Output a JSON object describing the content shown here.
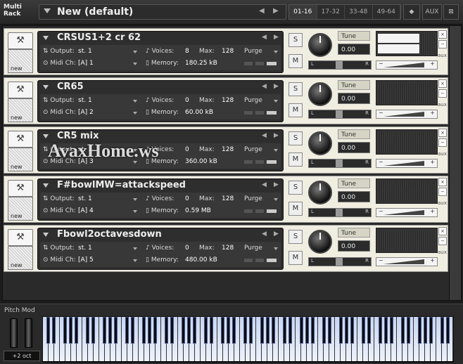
{
  "header": {
    "multi_rack_label_line1": "Multi",
    "multi_rack_label_line2": "Rack",
    "preset_name": "New (default)",
    "prev_arrow": "◀",
    "next_arrow": "▶",
    "ranges": [
      "01-16",
      "17-32",
      "33-48",
      "49-64"
    ],
    "active_range": "01-16",
    "aux_label": "AUX"
  },
  "instruments": [
    {
      "name": "CRSUS1+2 cr 62",
      "output_label": "Output:",
      "output": "st. 1",
      "voices_label": "Voices:",
      "voices": "8",
      "max_label": "Max:",
      "max": "128",
      "purge": "Purge",
      "midi_label": "Midi Ch:",
      "midi": "[A] 1",
      "memory_label": "Memory:",
      "memory": "180.25 kB",
      "tune_label": "Tune",
      "tune": "0.00",
      "solo": "S",
      "mute": "M",
      "new_label": "new",
      "meter_level": 0.72
    },
    {
      "name": "CR65",
      "output_label": "Output:",
      "output": "st. 1",
      "voices_label": "Voices:",
      "voices": "0",
      "max_label": "Max:",
      "max": "128",
      "purge": "Purge",
      "midi_label": "Midi Ch:",
      "midi": "[A] 2",
      "memory_label": "Memory:",
      "memory": "60.00 kB",
      "tune_label": "Tune",
      "tune": "0.00",
      "solo": "S",
      "mute": "M",
      "new_label": "new",
      "meter_level": 0
    },
    {
      "name": "CR5 mix",
      "output_label": "Output:",
      "output": "st. 1",
      "voices_label": "Voices:",
      "voices": "0",
      "max_label": "Max:",
      "max": "128",
      "purge": "Purge",
      "midi_label": "Midi Ch:",
      "midi": "[A] 3",
      "memory_label": "Memory:",
      "memory": "360.00 kB",
      "tune_label": "Tune",
      "tune": "0.00",
      "solo": "S",
      "mute": "M",
      "new_label": "new",
      "meter_level": 0
    },
    {
      "name": "F#bowlMW=attackspeed",
      "output_label": "Output:",
      "output": "st. 1",
      "voices_label": "Voices:",
      "voices": "0",
      "max_label": "Max:",
      "max": "128",
      "purge": "Purge",
      "midi_label": "Midi Ch:",
      "midi": "[A] 4",
      "memory_label": "Memory:",
      "memory": "0.59 MB",
      "tune_label": "Tune",
      "tune": "0.00",
      "solo": "S",
      "mute": "M",
      "new_label": "new",
      "meter_level": 0
    },
    {
      "name": "Fbowl2octavesdown",
      "output_label": "Output:",
      "output": "st. 1",
      "voices_label": "Voices:",
      "voices": "0",
      "max_label": "Max:",
      "max": "128",
      "purge": "Purge",
      "midi_label": "Midi Ch:",
      "midi": "[A] 5",
      "memory_label": "Memory:",
      "memory": "480.00 kB",
      "tune_label": "Tune",
      "tune": "0.00",
      "solo": "S",
      "mute": "M",
      "new_label": "new",
      "meter_level": 0
    }
  ],
  "pan_left": "L",
  "pan_right": "R",
  "vol_minus": "−",
  "vol_plus": "+",
  "side_close": "×",
  "side_minus": "−",
  "side_aux": "aux",
  "keyboard": {
    "pitch_mod_label": "Pitch Mod",
    "octave_label": "+2 oct"
  },
  "watermark": "AvaxHome.ws"
}
